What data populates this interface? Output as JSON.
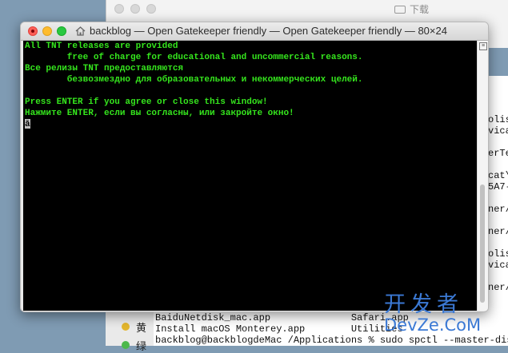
{
  "finder": {
    "title": "下载"
  },
  "terminal": {
    "title": "backblog — Open Gatekeeper friendly — Open Gatekeeper friendly — 80×24",
    "lines": [
      "All TNT releases are provided",
      "        free of charge for educational and uncommercial reasons.",
      "Все релизы TNT предоставляются",
      "        безвозмездно для образовательных и некоммерческих целей.",
      "",
      "Press ENTER if you agree or close this window!",
      "Нажмите ENTER, если вы согласны, или закройте окно!",
      "ā"
    ],
    "text_color": "#35e61d",
    "background": "#000000"
  },
  "background_terminal": {
    "right_fragments": [
      "olis",
      "vica",
      "",
      "erTe",
      "",
      "cat\\",
      "5A7-",
      "",
      "ner/",
      "",
      "ner/",
      "",
      "olis",
      "vica",
      "",
      "ner/"
    ],
    "bottom_lines": [
      "BaiduNetdisk_mac.app              Safari.app",
      "Install macOS Monterey.app        Utilities",
      "backblog@backblogdeMac /Applications % sudo spctl --master-disa"
    ],
    "side_labels": [
      "黄",
      "绿"
    ]
  },
  "watermark": {
    "cn": "开发者",
    "en": "DevZe.CoM"
  }
}
